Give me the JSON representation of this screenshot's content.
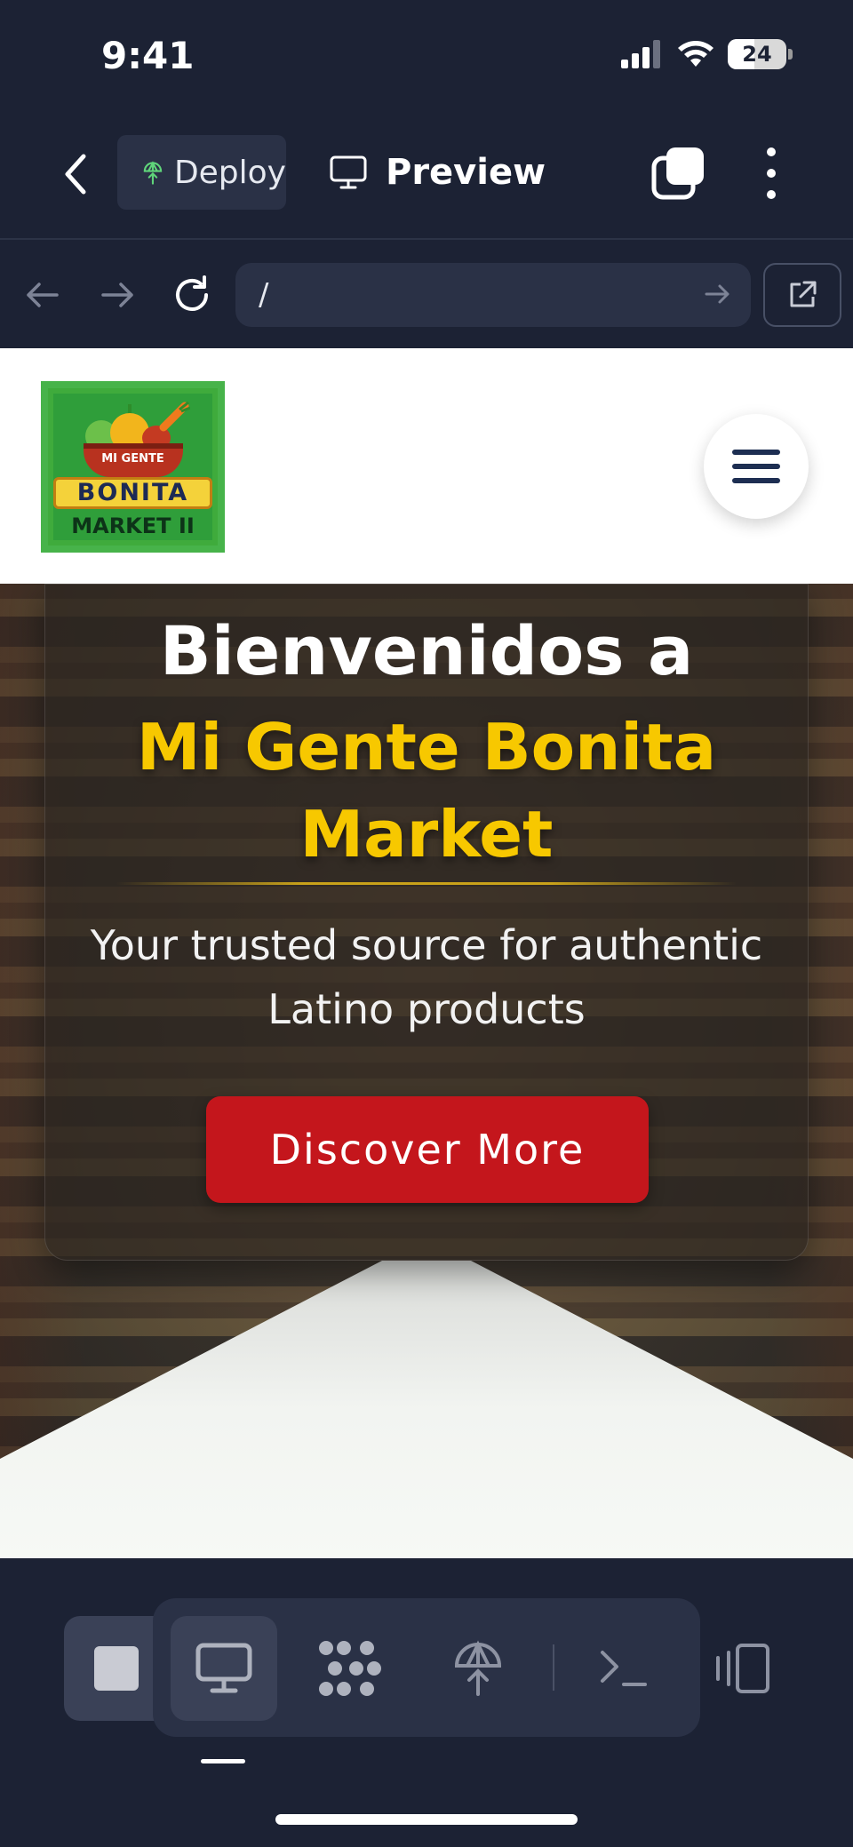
{
  "status_bar": {
    "time": "9:41",
    "battery": "24"
  },
  "top_nav": {
    "deploy_tab": "Deploy",
    "preview_tab": "Preview"
  },
  "url_bar": {
    "url": "/"
  },
  "site": {
    "logo": {
      "line1": "MI GENTE",
      "line2": "BONITA",
      "line3": "MARKET II"
    },
    "hero": {
      "title_line1": "Bienvenidos a",
      "title_line2": "Mi Gente Bonita Market",
      "subtitle": "Your trusted source for authentic Latino products",
      "cta": "Discover More"
    }
  },
  "colors": {
    "app_bg": "#1c2234",
    "accent_yellow": "#f7c800",
    "cta_red": "#c4161c",
    "deploy_green": "#5fd47a"
  },
  "bottom_bar": {
    "items": [
      "stop-icon",
      "desktop-icon",
      "workflow-icon",
      "deploy-icon",
      "terminal-icon",
      "devices-icon"
    ]
  }
}
